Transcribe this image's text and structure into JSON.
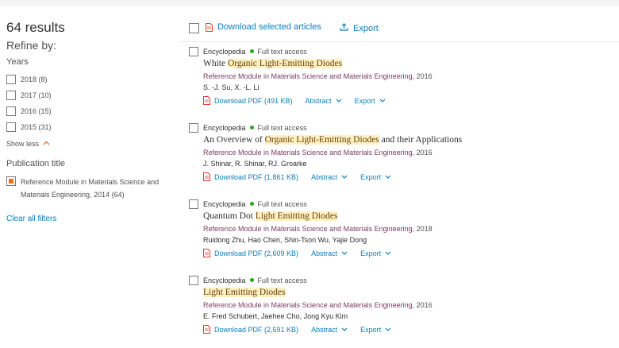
{
  "sidebar": {
    "results_count": "64 results",
    "refine_label": "Refine by:",
    "years_title": "Years",
    "years": [
      {
        "label": "2018 (8)"
      },
      {
        "label": "2017 (10)"
      },
      {
        "label": "2016 (15)"
      },
      {
        "label": "2015 (31)"
      }
    ],
    "show_less": "Show less",
    "publication_title": "Publication title",
    "publications": [
      {
        "label_line1": "Reference Module in Materials Science and",
        "label_line2": "Materials Engineering, 2014 (64)",
        "checked": true
      }
    ],
    "clear_filters": "Clear all filters"
  },
  "toolbar": {
    "download_selected": "Download selected articles",
    "export": "Export"
  },
  "results": [
    {
      "type": "Encyclopedia",
      "access": "Full text access",
      "title_parts": [
        {
          "text": "White ",
          "hl": false
        },
        {
          "text": "Organic Light-Emitting Diodes",
          "hl": true
        }
      ],
      "title_plain": "White Organic Light-Emitting Diodes",
      "source": "Reference Module in Materials Science and Materials Engineering",
      "year": ", 2016",
      "authors": "S. -J. Su, X. -L. Li",
      "download_pdf": "Download PDF (491 KB)",
      "abstract": "Abstract",
      "export": "Export"
    },
    {
      "type": "Encyclopedia",
      "access": "Full text access",
      "title_parts": [
        {
          "text": "An Overview of ",
          "hl": false
        },
        {
          "text": "Organic Light-Emitting Diodes",
          "hl": true
        },
        {
          "text": " and their Applications",
          "hl": false
        }
      ],
      "title_plain": "An Overview of Organic Light-Emitting Diodes and their Applications",
      "source": "Reference Module in Materials Science and Materials Engineering",
      "year": ", 2016",
      "authors": "J. Shinar, R. Shinar, RJ. Groarke",
      "download_pdf": "Download PDF (1,861 KB)",
      "abstract": "Abstract",
      "export": "Export"
    },
    {
      "type": "Encyclopedia",
      "access": "Full text access",
      "title_parts": [
        {
          "text": "Quantum Dot ",
          "hl": false
        },
        {
          "text": "Light Emitting Diodes",
          "hl": true
        }
      ],
      "title_plain": "Quantum Dot Light Emitting Diodes",
      "source": "Reference Module in Materials Science and Materials Engineering",
      "year": ", 2018",
      "authors": "Ruidong Zhu, Hao Chen, Shin-Tson Wu, Yajie Dong",
      "download_pdf": "Download PDF (2,609 KB)",
      "abstract": "Abstract",
      "export": "Export"
    },
    {
      "type": "Encyclopedia",
      "access": "Full text access",
      "title_parts": [
        {
          "text": "Light Emitting Diodes",
          "hl": true
        }
      ],
      "title_plain": "Light Emitting Diodes",
      "source": "Reference Module in Materials Science and Materials Engineering",
      "year": ", 2016",
      "authors": "E. Fred Schubert, Jaehee Cho, Jong Kyu Kim",
      "download_pdf": "Download PDF (2,591 KB)",
      "abstract": "Abstract",
      "export": "Export"
    }
  ],
  "icons": {
    "pdf": "pdf-icon",
    "export": "upload-icon",
    "chevron": "chevron-down-icon",
    "show_less": "chevron-up-icon"
  },
  "colors": {
    "link": "#0c7dbb",
    "accent": "#e9711c",
    "access_dot": "#29a61b",
    "highlight": "#fdf1c4",
    "source": "#7a3c60"
  }
}
